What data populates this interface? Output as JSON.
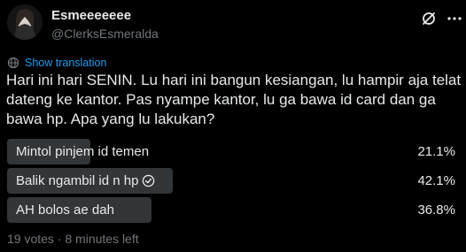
{
  "user": {
    "display_name": "Esmeeeeeee",
    "handle": "@ClerksEsmeralda"
  },
  "header_icons": [
    "grok-icon",
    "more-icon"
  ],
  "translate": {
    "icon": "globe-icon",
    "label": "Show translation"
  },
  "tweet": {
    "text": "Hari ini hari SENIN. Lu hari ini bangun kesiangan, lu hampir aja telat dateng ke kantor. Pas nyampe kantor, lu ga bawa id card dan ga bawa hp. Apa yang lu lakukan?"
  },
  "poll": {
    "options": [
      {
        "label": "Mintol pinjem id temen",
        "percent_label": "21.1%",
        "percent": 21.1,
        "leader": false
      },
      {
        "label": "Balik ngambil id n hp",
        "percent_label": "42.1%",
        "percent": 42.1,
        "leader": true
      },
      {
        "label": "AH bolos ae dah",
        "percent_label": "36.8%",
        "percent": 36.8,
        "leader": false
      }
    ],
    "meta": "19 votes · 8 minutes left"
  },
  "colors": {
    "background": "#000000",
    "text": "#e7e9ea",
    "muted": "#71767b",
    "link": "#1d9bf0",
    "bar": "#333639"
  }
}
